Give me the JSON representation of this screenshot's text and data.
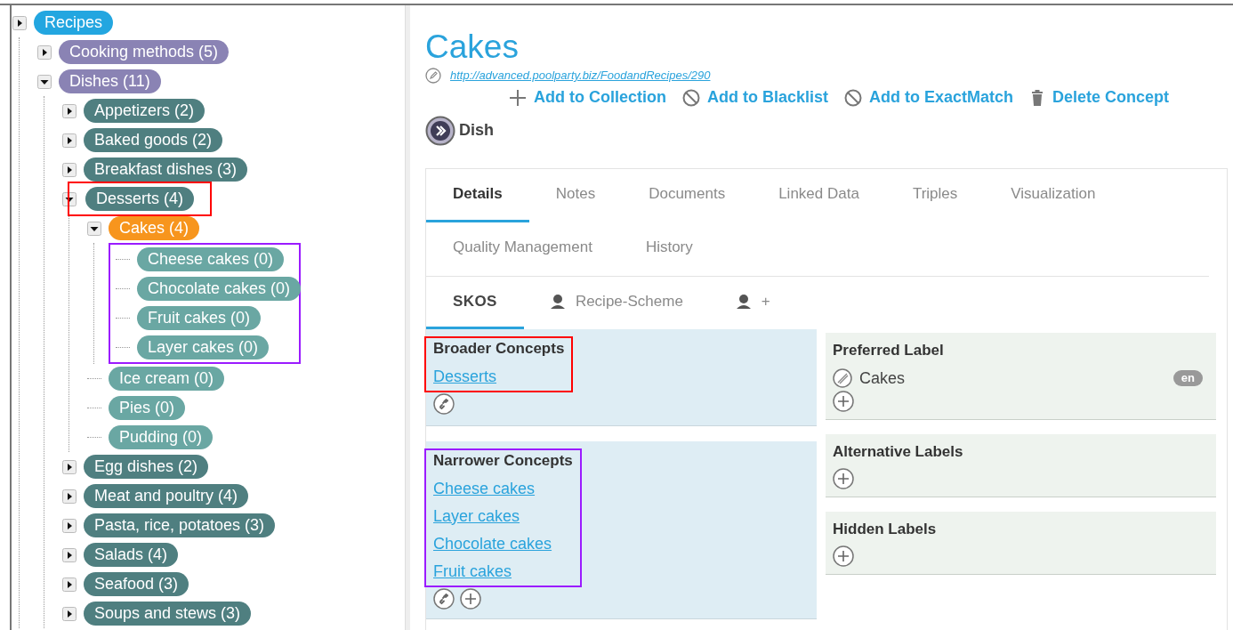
{
  "tree": [
    {
      "label": "Recipes",
      "color": "#23a6e0",
      "kind": "branch",
      "expanded": false,
      "children": [
        {
          "label": "Cooking methods (5)",
          "color": "#8a83b4",
          "kind": "branch",
          "expanded": false
        },
        {
          "label": "Dishes (11)",
          "color": "#8a83b4",
          "kind": "branch",
          "expanded": true,
          "children": [
            {
              "label": "Appetizers (2)",
              "color": "#4f7f80",
              "kind": "branch",
              "expanded": false
            },
            {
              "label": "Baked goods (2)",
              "color": "#4f7f80",
              "kind": "branch",
              "expanded": false
            },
            {
              "label": "Breakfast dishes (3)",
              "color": "#4f7f80",
              "kind": "branch",
              "expanded": false
            },
            {
              "label": "Desserts (4)",
              "color": "#4f7f80",
              "kind": "branch",
              "expanded": true,
              "frame": {
                "color": "#ff0000"
              },
              "children": [
                {
                  "label": "Cakes (4)",
                  "color": "#f7951d",
                  "kind": "branch",
                  "expanded": true,
                  "children_frame": {
                    "color": "#9b1bff"
                  },
                  "children": [
                    {
                      "label": "Cheese cakes (0)",
                      "color": "#6aa7a3",
                      "kind": "leaf"
                    },
                    {
                      "label": "Chocolate cakes (0)",
                      "color": "#6aa7a3",
                      "kind": "leaf"
                    },
                    {
                      "label": "Fruit cakes (0)",
                      "color": "#6aa7a3",
                      "kind": "leaf"
                    },
                    {
                      "label": "Layer cakes (0)",
                      "color": "#6aa7a3",
                      "kind": "leaf"
                    }
                  ]
                },
                {
                  "label": "Ice cream (0)",
                  "color": "#6aa7a3",
                  "kind": "leaf"
                },
                {
                  "label": "Pies (0)",
                  "color": "#6aa7a3",
                  "kind": "leaf"
                },
                {
                  "label": "Pudding (0)",
                  "color": "#6aa7a3",
                  "kind": "leaf"
                }
              ]
            },
            {
              "label": "Egg dishes (2)",
              "color": "#4f7f80",
              "kind": "branch",
              "expanded": false
            },
            {
              "label": "Meat and poultry (4)",
              "color": "#4f7f80",
              "kind": "branch",
              "expanded": false
            },
            {
              "label": "Pasta, rice, potatoes (3)",
              "color": "#4f7f80",
              "kind": "branch",
              "expanded": false
            },
            {
              "label": "Salads (4)",
              "color": "#4f7f80",
              "kind": "branch",
              "expanded": false
            },
            {
              "label": "Seafood (3)",
              "color": "#4f7f80",
              "kind": "branch",
              "expanded": false
            },
            {
              "label": "Soups and stews (3)",
              "color": "#4f7f80",
              "kind": "branch",
              "expanded": false
            }
          ]
        }
      ]
    }
  ],
  "concept": {
    "title": "Cakes",
    "uri": "http://advanced.poolparty.biz/FoodandRecipes/290",
    "type": "Dish"
  },
  "actions": [
    {
      "label": "Add to Collection",
      "kind": "add"
    },
    {
      "label": "Add to Blacklist",
      "kind": "ban"
    },
    {
      "label": "Add to ExactMatch",
      "kind": "ban"
    },
    {
      "label": "Delete Concept",
      "kind": "delete"
    }
  ],
  "tabs": [
    {
      "label": "Details",
      "selected": true
    },
    {
      "label": "Notes",
      "selected": false
    },
    {
      "label": "Documents",
      "selected": false
    },
    {
      "label": "Linked Data",
      "selected": false
    },
    {
      "label": "Triples",
      "selected": false
    },
    {
      "label": "Visualization",
      "selected": false
    },
    {
      "label": "Quality Management",
      "selected": false
    },
    {
      "label": "History",
      "selected": false
    }
  ],
  "subtabs": [
    {
      "label": "SKOS",
      "kind": "plain",
      "selected": true
    },
    {
      "label": "Recipe-Scheme",
      "kind": "user",
      "selected": false
    },
    {
      "label": "+",
      "kind": "user",
      "selected": false
    }
  ],
  "relations": [
    {
      "title": "Broader Concepts",
      "frame": {
        "color": "#ff0000"
      },
      "links": [
        "Desserts"
      ],
      "controls": [
        {
          "kind": "link"
        }
      ]
    },
    {
      "title": "Narrower Concepts",
      "frame": {
        "color": "#9b1bff"
      },
      "links": [
        "Cheese cakes",
        "Layer cakes",
        "Chocolate cakes",
        "Fruit cakes"
      ],
      "controls": [
        {
          "kind": "link"
        },
        {
          "kind": "add"
        }
      ]
    }
  ],
  "labels": [
    {
      "title": "Preferred Label",
      "values": [
        {
          "text": "Cakes",
          "lang": "en"
        }
      ]
    },
    {
      "title": "Alternative Labels"
    },
    {
      "title": "Hidden Labels"
    }
  ]
}
